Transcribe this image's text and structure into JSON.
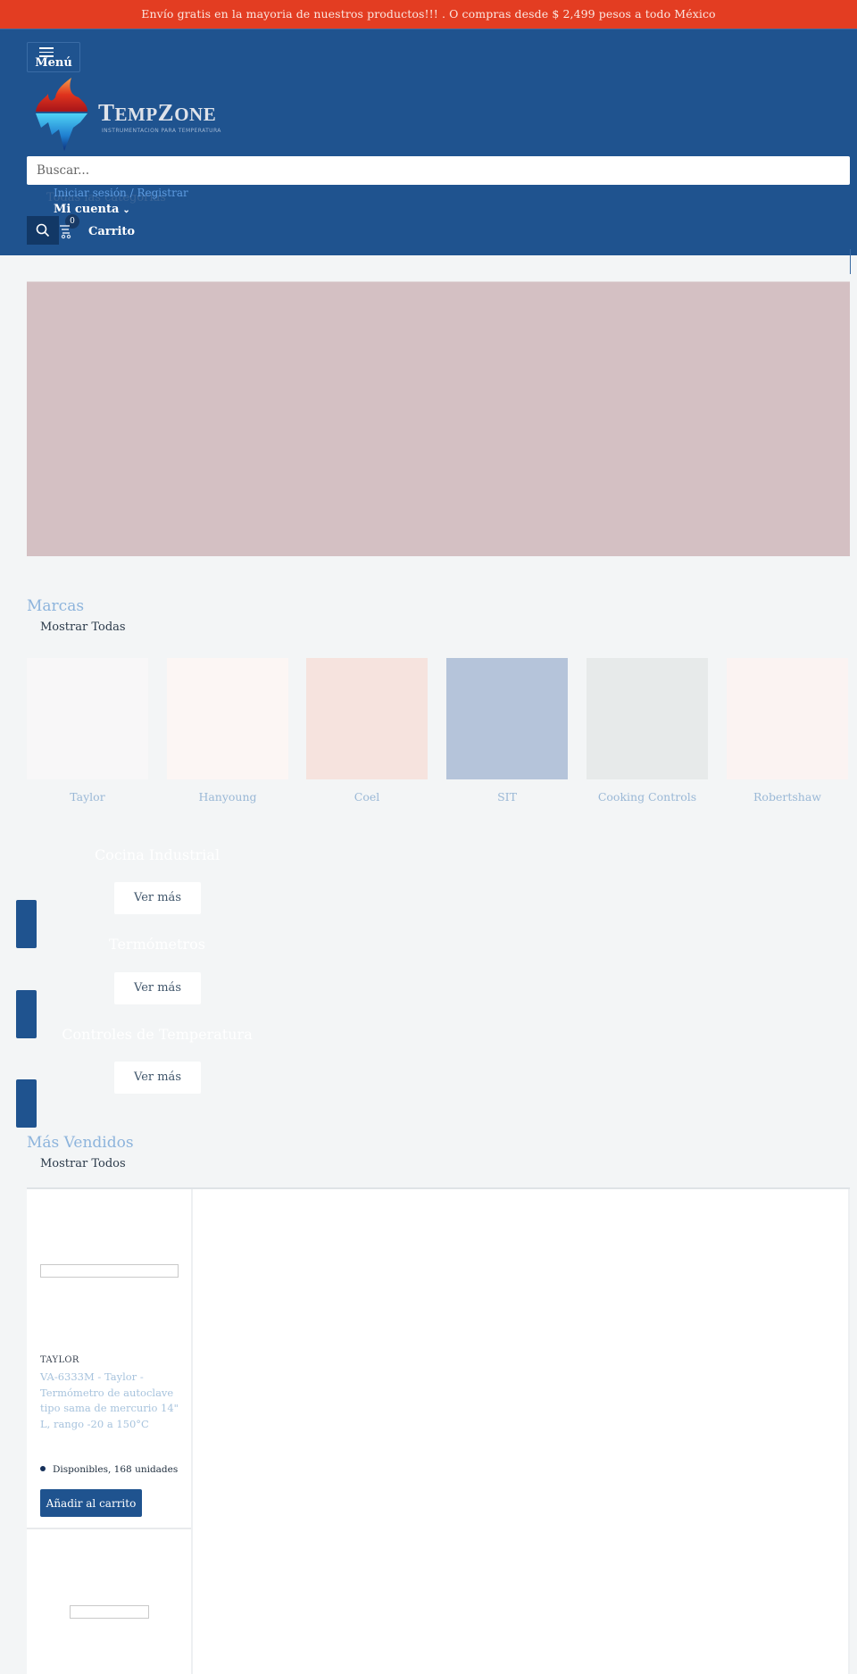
{
  "announcement": "Envío gratis en la mayoria de nuestros productos!!! . O compras desde $ 2,499 pesos a todo México",
  "header": {
    "menu_label": "Menú",
    "logo_main_big1": "T",
    "logo_main_small1": "EMP",
    "logo_main_big2": "Z",
    "logo_main_small2": "ONE",
    "logo_tagline": "INSTRUMENTACION PARA TEMPERATURA",
    "search_placeholder": "Buscar...",
    "categories_label": "Todas las categorías",
    "login_label": "Iniciar sesión / Registrar",
    "account_label": "Mi cuenta",
    "cart_count": "0",
    "cart_label": "Carrito"
  },
  "brands": {
    "title": "Marcas",
    "show_all": "Mostrar Todas",
    "items": [
      {
        "name": "Taylor",
        "color": "#f8f7f8"
      },
      {
        "name": "Hanyoung",
        "color": "#fcf6f4"
      },
      {
        "name": "Coel",
        "color": "#f6e3de"
      },
      {
        "name": "SIT",
        "color": "#b5c4da"
      },
      {
        "name": "Cooking Controls",
        "color": "#e7eaea"
      },
      {
        "name": "Robertshaw",
        "color": "#fbf3f2"
      }
    ]
  },
  "categories": [
    {
      "title": "Cocina Industrial",
      "button": "Ver más"
    },
    {
      "title": "Termómetros",
      "button": "Ver más"
    },
    {
      "title": "Controles de Temperatura",
      "button": "Ver más"
    }
  ],
  "bestsellers": {
    "title": "Más Vendidos",
    "show_all": "Mostrar Todos",
    "products": [
      {
        "vendor": "TAYLOR",
        "title": "VA-6333M - Taylor - Termómetro de autoclave tipo sama de mercurio 14\" L, rango -20 a 150°C",
        "stock": "Disponibles, 168 unidades",
        "add_to_cart": "Añadir al carrito"
      }
    ]
  },
  "colors": {
    "announcement_bg": "#e33d22",
    "header_bg": "#1f538f",
    "accent": "#1f538f",
    "hero_bg": "#d4c0c3"
  }
}
